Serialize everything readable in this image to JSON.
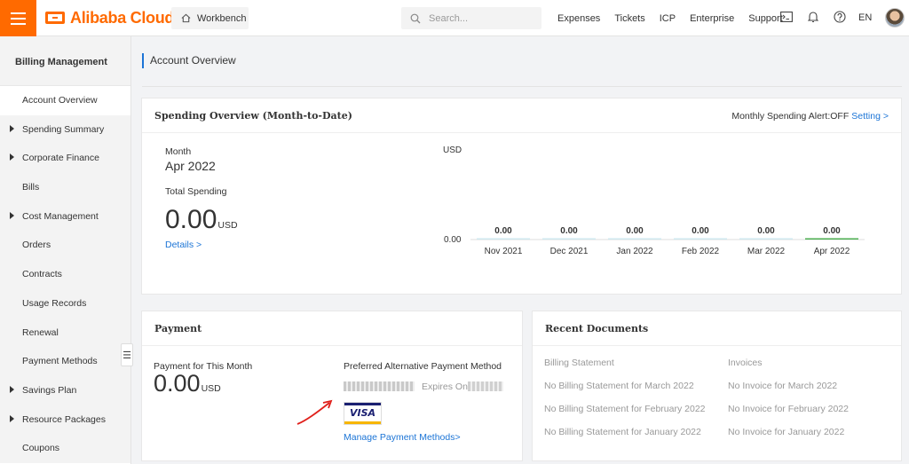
{
  "header": {
    "logo": "Alibaba Cloud",
    "workbench": "Workbench",
    "search_placeholder": "Search...",
    "nav": [
      "Expenses",
      "Tickets",
      "ICP",
      "Enterprise",
      "Support"
    ],
    "icons": [
      "terminal-icon",
      "bell-icon",
      "help-icon"
    ],
    "lang": "EN"
  },
  "sidebar": {
    "title": "Billing Management",
    "items": [
      {
        "label": "Account Overview",
        "expandable": false,
        "active": true
      },
      {
        "label": "Spending Summary",
        "expandable": true
      },
      {
        "label": "Corporate Finance",
        "expandable": true
      },
      {
        "label": "Bills",
        "expandable": false
      },
      {
        "label": "Cost Management",
        "expandable": true
      },
      {
        "label": "Orders",
        "expandable": false
      },
      {
        "label": "Contracts",
        "expandable": false
      },
      {
        "label": "Usage Records",
        "expandable": false
      },
      {
        "label": "Renewal",
        "expandable": false
      },
      {
        "label": "Payment Methods",
        "expandable": false
      },
      {
        "label": "Savings Plan",
        "expandable": true
      },
      {
        "label": "Resource Packages",
        "expandable": true
      },
      {
        "label": "Coupons",
        "expandable": false
      }
    ]
  },
  "page_title": "Account Overview",
  "spending": {
    "title": "Spending Overview (Month-to-Date)",
    "alert_label": "Monthly Spending Alert:OFF",
    "setting_link": "Setting >",
    "month_label": "Month",
    "month": "Apr 2022",
    "total_label": "Total Spending",
    "total": "0.00",
    "total_unit": "USD",
    "details_link": "Details >"
  },
  "chart_data": {
    "type": "bar",
    "ylabel": "USD",
    "categories": [
      "Nov 2021",
      "Dec 2021",
      "Jan 2022",
      "Feb 2022",
      "Mar 2022",
      "Apr 2022"
    ],
    "values": [
      0.0,
      0.0,
      0.0,
      0.0,
      0.0,
      0.0
    ],
    "data_labels": [
      "0.00",
      "0.00",
      "0.00",
      "0.00",
      "0.00",
      "0.00"
    ],
    "y_ticks": [
      "0.00"
    ],
    "bar_color": "#cfe8ef",
    "last_bar_color": "#4caf50"
  },
  "payment": {
    "title": "Payment",
    "month_label": "Payment for This Month",
    "amount": "0.00",
    "unit": "USD",
    "preferred_label": "Preferred Alternative Payment Method",
    "expires_label": "Expires On",
    "card_brand": "VISA",
    "manage_link": "Manage Payment Methods>"
  },
  "recent": {
    "title": "Recent Documents",
    "billing_header": "Billing Statement",
    "invoice_header": "Invoices",
    "billing": [
      "No Billing Statement for March 2022",
      "No Billing Statement for February 2022",
      "No Billing Statement for January 2022"
    ],
    "invoices": [
      "No Invoice for March 2022",
      "No Invoice for February 2022",
      "No Invoice for January 2022"
    ]
  },
  "colors": {
    "brand": "#ff6a00",
    "link": "#1b74d6",
    "annotation": "#e0201b"
  }
}
